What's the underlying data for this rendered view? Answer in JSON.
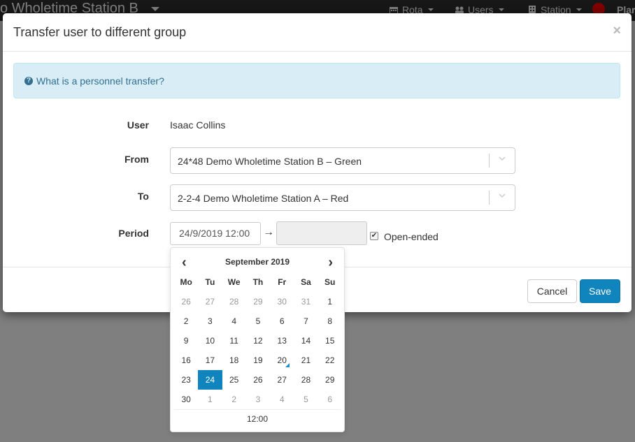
{
  "navbar": {
    "title": "o Wholetime Station B",
    "items": [
      {
        "label": "Rota",
        "icon": "calendar-icon"
      },
      {
        "label": "Users",
        "icon": "users-icon"
      },
      {
        "label": "Station",
        "icon": "building-icon"
      }
    ],
    "status_color": "#ff0000",
    "plan_label": "Plar"
  },
  "modal": {
    "title": "Transfer user to different group",
    "close_label": "×",
    "info_link": "What is a personnel transfer?",
    "fields": {
      "user_label": "User",
      "user_value": "Isaac Collins",
      "from_label": "From",
      "from_value": "24*48 Demo Wholetime Station B – Green",
      "to_label": "To",
      "to_value": "2-2-4 Demo Wholetime Station A – Red",
      "period_label": "Period",
      "period_start": "24/9/2019 12:00",
      "period_end": "",
      "arrow": "→",
      "open_ended_label": "Open-ended",
      "open_ended_checked": true
    },
    "footer": {
      "cancel_label": "Cancel",
      "save_label": "Save"
    }
  },
  "datepicker": {
    "prev": "‹",
    "next": "›",
    "month_label": "September 2019",
    "weekdays": [
      "Mo",
      "Tu",
      "We",
      "Th",
      "Fr",
      "Sa",
      "Su"
    ],
    "weeks": [
      [
        {
          "d": "26",
          "m": true
        },
        {
          "d": "27",
          "m": true
        },
        {
          "d": "28",
          "m": true
        },
        {
          "d": "29",
          "m": true
        },
        {
          "d": "30",
          "m": true
        },
        {
          "d": "31",
          "m": true
        },
        {
          "d": "1"
        }
      ],
      [
        {
          "d": "2"
        },
        {
          "d": "3"
        },
        {
          "d": "4"
        },
        {
          "d": "5"
        },
        {
          "d": "6"
        },
        {
          "d": "7"
        },
        {
          "d": "8"
        }
      ],
      [
        {
          "d": "9"
        },
        {
          "d": "10"
        },
        {
          "d": "11"
        },
        {
          "d": "12"
        },
        {
          "d": "13"
        },
        {
          "d": "14"
        },
        {
          "d": "15"
        }
      ],
      [
        {
          "d": "16"
        },
        {
          "d": "17"
        },
        {
          "d": "18"
        },
        {
          "d": "19"
        },
        {
          "d": "20",
          "today": true
        },
        {
          "d": "21"
        },
        {
          "d": "22"
        }
      ],
      [
        {
          "d": "23"
        },
        {
          "d": "24",
          "active": true
        },
        {
          "d": "25"
        },
        {
          "d": "26"
        },
        {
          "d": "27"
        },
        {
          "d": "28"
        },
        {
          "d": "29"
        }
      ],
      [
        {
          "d": "30"
        },
        {
          "d": "1",
          "m": true
        },
        {
          "d": "2",
          "m": true
        },
        {
          "d": "3",
          "m": true
        },
        {
          "d": "4",
          "m": true
        },
        {
          "d": "5",
          "m": true
        },
        {
          "d": "6",
          "m": true
        }
      ]
    ],
    "time": "12:00",
    "accent_color": "#0f84bd"
  }
}
